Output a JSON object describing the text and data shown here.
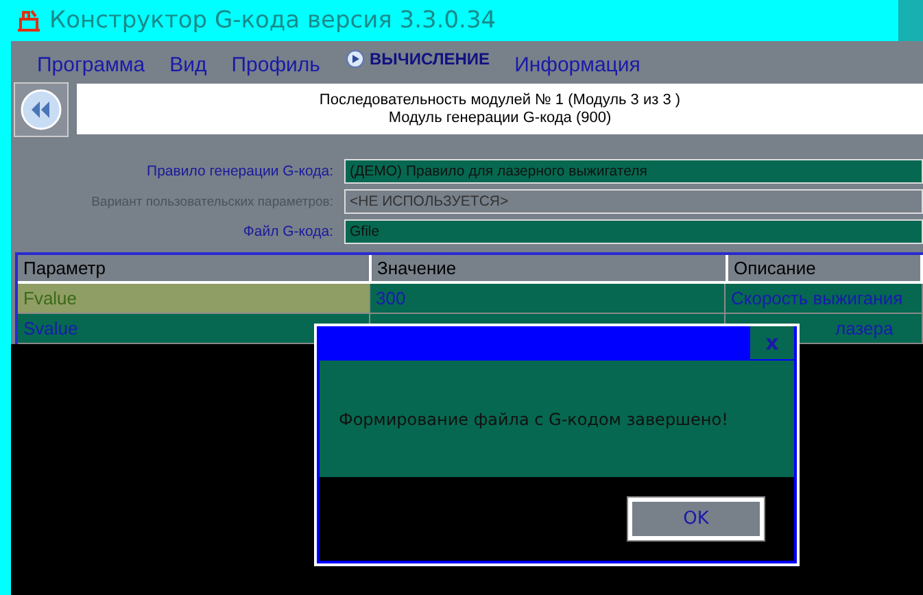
{
  "window": {
    "title": "Конструктор G-кода версия 3.3.0.34"
  },
  "menu": [
    {
      "label": "Программа",
      "kind": "text",
      "selected": false
    },
    {
      "label": "Вид",
      "kind": "text",
      "selected": false
    },
    {
      "label": "Профиль",
      "kind": "text",
      "selected": false
    },
    {
      "label": "ВЫЧИСЛЕНИЕ",
      "kind": "icon",
      "selected": true
    },
    {
      "label": "Информация",
      "kind": "text",
      "selected": false
    }
  ],
  "module_header": {
    "line_1": "Последовательность модулей № 1 (Модуль 3 из 3 )",
    "line_2": "Модуль генерации G-кода (900)"
  },
  "fields": [
    {
      "label": "Правило генерации G-кода:",
      "value": "(ДЕМО) Правило для лазерного выжигателя",
      "disabled": false
    },
    {
      "label": "Вариант пользовательских параметров:",
      "value": "<НЕ ИСПОЛЬЗУЕТСЯ>",
      "disabled": true
    },
    {
      "label": "Файл G-кода:",
      "value": "Gfile",
      "disabled": false
    }
  ],
  "table": {
    "columns": [
      "Параметр",
      "Значение",
      "Описание"
    ],
    "rows": [
      {
        "parameter": "Fvalue",
        "value": "300",
        "description": "Скорость выжигания",
        "selected": true
      },
      {
        "parameter": "Svalue",
        "description": "лазера",
        "selected": false
      }
    ]
  },
  "dialog": {
    "close": "x",
    "message": "Формирование файла с G-кодом завершено!",
    "button": "OK"
  }
}
